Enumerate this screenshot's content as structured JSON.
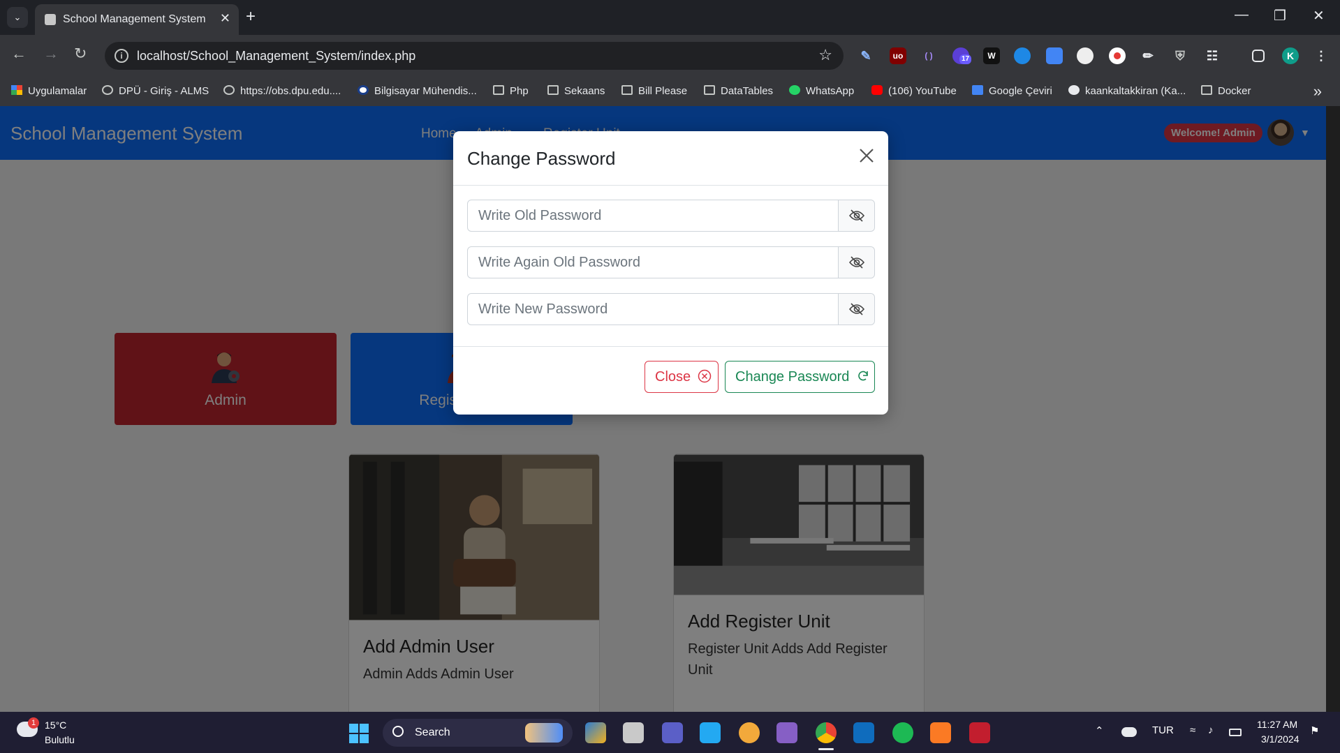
{
  "browser": {
    "tab_title": "School Management System",
    "url": "localhost/School_Management_System/index.php",
    "bookmarks": [
      "Uygulamalar",
      "DPÜ - Giriş - ALMS",
      "https://obs.dpu.edu....",
      "Bilgisayar Mühendis...",
      "Php",
      "Sekaans",
      "Bill Please",
      "DataTables",
      "WhatsApp",
      "(106) YouTube",
      "Google Çeviri",
      "kaankaltakkiran (Ka...",
      "Docker"
    ],
    "extension_badge": "17",
    "profile_initial": "K"
  },
  "app": {
    "brand": "School Management System",
    "nav": [
      "Home",
      "Admin",
      "Register Unit"
    ],
    "welcome": "Welcome! Admin",
    "role_cards": [
      {
        "label": "Admin",
        "color": "#c1242f"
      },
      {
        "label": "Register Unit",
        "color": "#0d6efd"
      }
    ],
    "cards": [
      {
        "title": "Add Admin User",
        "text": "Admin Adds Admin User"
      },
      {
        "title": "Add Register Unit",
        "text": "Register Unit Adds Add Register Unit"
      }
    ]
  },
  "modal": {
    "title": "Change Password",
    "fields": [
      {
        "placeholder": "Write Old Password"
      },
      {
        "placeholder": "Write Again Old Password"
      },
      {
        "placeholder": "Write New Password"
      }
    ],
    "close_label": "Close",
    "submit_label": "Change Password"
  },
  "taskbar": {
    "weather_temp": "15°C",
    "weather_desc": "Bulutlu",
    "weather_badge": "1",
    "search_label": "Search",
    "language": "TUR",
    "time": "11:27 AM",
    "date": "3/1/2024"
  }
}
